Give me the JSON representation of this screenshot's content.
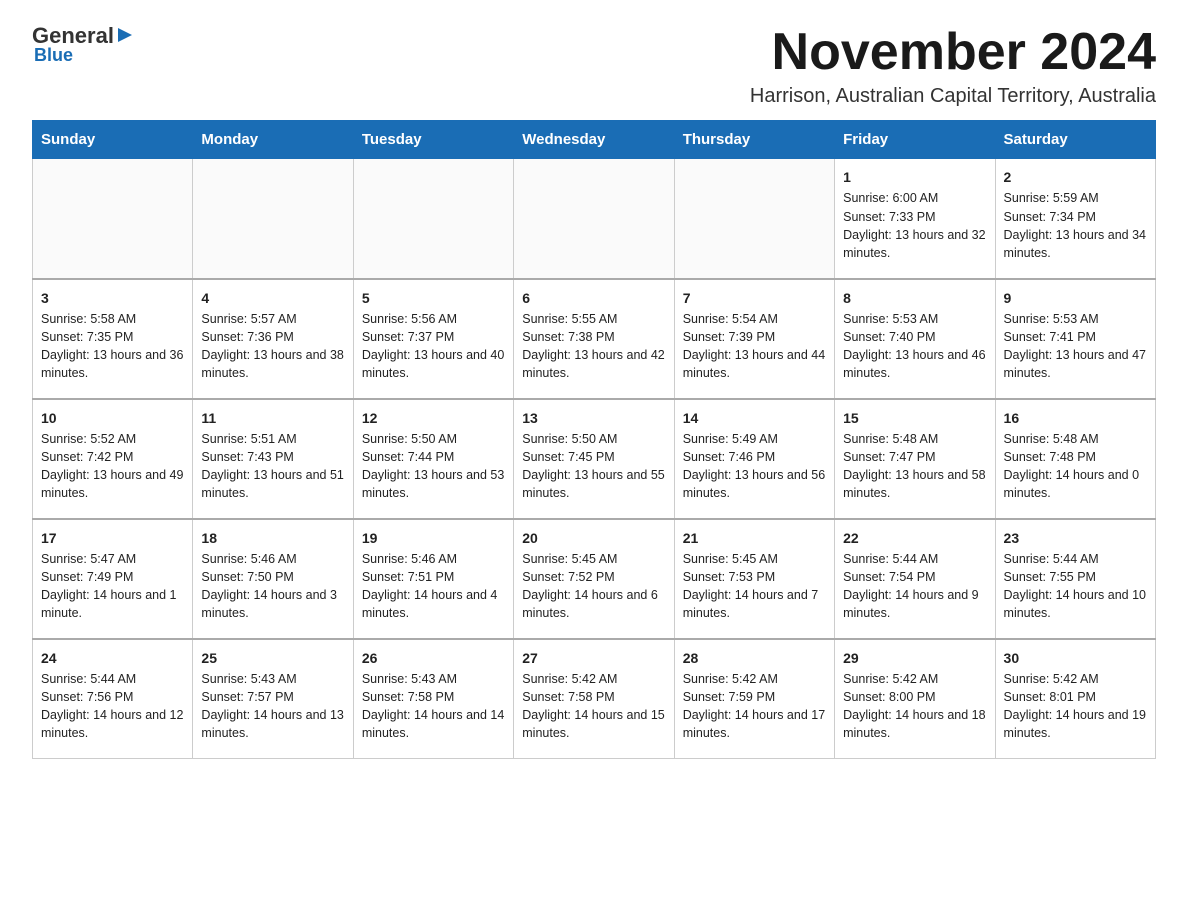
{
  "logo": {
    "general": "General",
    "triangle": "▶",
    "blue": "Blue"
  },
  "header": {
    "month_year": "November 2024",
    "location": "Harrison, Australian Capital Territory, Australia"
  },
  "weekdays": [
    "Sunday",
    "Monday",
    "Tuesday",
    "Wednesday",
    "Thursday",
    "Friday",
    "Saturday"
  ],
  "weeks": [
    [
      {
        "day": "",
        "info": ""
      },
      {
        "day": "",
        "info": ""
      },
      {
        "day": "",
        "info": ""
      },
      {
        "day": "",
        "info": ""
      },
      {
        "day": "",
        "info": ""
      },
      {
        "day": "1",
        "info": "Sunrise: 6:00 AM\nSunset: 7:33 PM\nDaylight: 13 hours and 32 minutes."
      },
      {
        "day": "2",
        "info": "Sunrise: 5:59 AM\nSunset: 7:34 PM\nDaylight: 13 hours and 34 minutes."
      }
    ],
    [
      {
        "day": "3",
        "info": "Sunrise: 5:58 AM\nSunset: 7:35 PM\nDaylight: 13 hours and 36 minutes."
      },
      {
        "day": "4",
        "info": "Sunrise: 5:57 AM\nSunset: 7:36 PM\nDaylight: 13 hours and 38 minutes."
      },
      {
        "day": "5",
        "info": "Sunrise: 5:56 AM\nSunset: 7:37 PM\nDaylight: 13 hours and 40 minutes."
      },
      {
        "day": "6",
        "info": "Sunrise: 5:55 AM\nSunset: 7:38 PM\nDaylight: 13 hours and 42 minutes."
      },
      {
        "day": "7",
        "info": "Sunrise: 5:54 AM\nSunset: 7:39 PM\nDaylight: 13 hours and 44 minutes."
      },
      {
        "day": "8",
        "info": "Sunrise: 5:53 AM\nSunset: 7:40 PM\nDaylight: 13 hours and 46 minutes."
      },
      {
        "day": "9",
        "info": "Sunrise: 5:53 AM\nSunset: 7:41 PM\nDaylight: 13 hours and 47 minutes."
      }
    ],
    [
      {
        "day": "10",
        "info": "Sunrise: 5:52 AM\nSunset: 7:42 PM\nDaylight: 13 hours and 49 minutes."
      },
      {
        "day": "11",
        "info": "Sunrise: 5:51 AM\nSunset: 7:43 PM\nDaylight: 13 hours and 51 minutes."
      },
      {
        "day": "12",
        "info": "Sunrise: 5:50 AM\nSunset: 7:44 PM\nDaylight: 13 hours and 53 minutes."
      },
      {
        "day": "13",
        "info": "Sunrise: 5:50 AM\nSunset: 7:45 PM\nDaylight: 13 hours and 55 minutes."
      },
      {
        "day": "14",
        "info": "Sunrise: 5:49 AM\nSunset: 7:46 PM\nDaylight: 13 hours and 56 minutes."
      },
      {
        "day": "15",
        "info": "Sunrise: 5:48 AM\nSunset: 7:47 PM\nDaylight: 13 hours and 58 minutes."
      },
      {
        "day": "16",
        "info": "Sunrise: 5:48 AM\nSunset: 7:48 PM\nDaylight: 14 hours and 0 minutes."
      }
    ],
    [
      {
        "day": "17",
        "info": "Sunrise: 5:47 AM\nSunset: 7:49 PM\nDaylight: 14 hours and 1 minute."
      },
      {
        "day": "18",
        "info": "Sunrise: 5:46 AM\nSunset: 7:50 PM\nDaylight: 14 hours and 3 minutes."
      },
      {
        "day": "19",
        "info": "Sunrise: 5:46 AM\nSunset: 7:51 PM\nDaylight: 14 hours and 4 minutes."
      },
      {
        "day": "20",
        "info": "Sunrise: 5:45 AM\nSunset: 7:52 PM\nDaylight: 14 hours and 6 minutes."
      },
      {
        "day": "21",
        "info": "Sunrise: 5:45 AM\nSunset: 7:53 PM\nDaylight: 14 hours and 7 minutes."
      },
      {
        "day": "22",
        "info": "Sunrise: 5:44 AM\nSunset: 7:54 PM\nDaylight: 14 hours and 9 minutes."
      },
      {
        "day": "23",
        "info": "Sunrise: 5:44 AM\nSunset: 7:55 PM\nDaylight: 14 hours and 10 minutes."
      }
    ],
    [
      {
        "day": "24",
        "info": "Sunrise: 5:44 AM\nSunset: 7:56 PM\nDaylight: 14 hours and 12 minutes."
      },
      {
        "day": "25",
        "info": "Sunrise: 5:43 AM\nSunset: 7:57 PM\nDaylight: 14 hours and 13 minutes."
      },
      {
        "day": "26",
        "info": "Sunrise: 5:43 AM\nSunset: 7:58 PM\nDaylight: 14 hours and 14 minutes."
      },
      {
        "day": "27",
        "info": "Sunrise: 5:42 AM\nSunset: 7:58 PM\nDaylight: 14 hours and 15 minutes."
      },
      {
        "day": "28",
        "info": "Sunrise: 5:42 AM\nSunset: 7:59 PM\nDaylight: 14 hours and 17 minutes."
      },
      {
        "day": "29",
        "info": "Sunrise: 5:42 AM\nSunset: 8:00 PM\nDaylight: 14 hours and 18 minutes."
      },
      {
        "day": "30",
        "info": "Sunrise: 5:42 AM\nSunset: 8:01 PM\nDaylight: 14 hours and 19 minutes."
      }
    ]
  ]
}
